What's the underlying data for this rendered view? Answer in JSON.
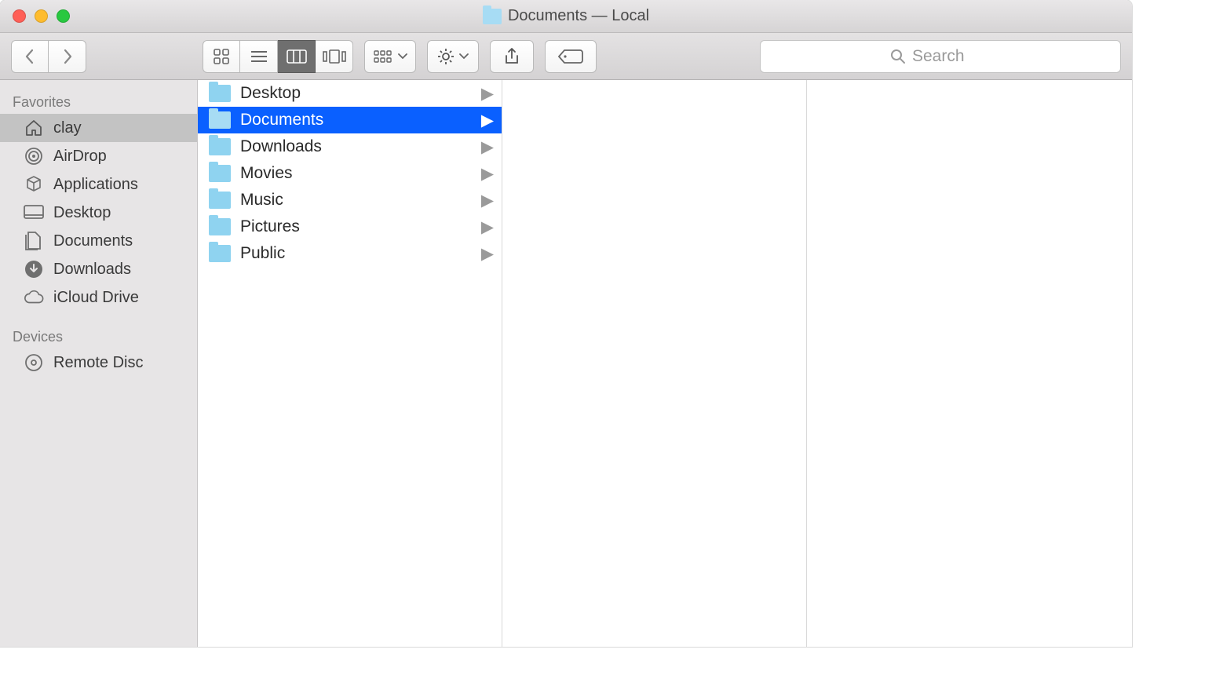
{
  "window": {
    "title": "Documents — Local"
  },
  "toolbar": {
    "search_placeholder": "Search"
  },
  "sidebar": {
    "sections": [
      {
        "heading": "Favorites",
        "items": [
          {
            "icon": "home-icon",
            "label": "clay",
            "selected": true
          },
          {
            "icon": "airdrop-icon",
            "label": "AirDrop",
            "selected": false
          },
          {
            "icon": "applications-icon",
            "label": "Applications",
            "selected": false
          },
          {
            "icon": "desktop-icon",
            "label": "Desktop",
            "selected": false
          },
          {
            "icon": "documents-icon",
            "label": "Documents",
            "selected": false
          },
          {
            "icon": "downloads-icon",
            "label": "Downloads",
            "selected": false
          },
          {
            "icon": "cloud-icon",
            "label": "iCloud Drive",
            "selected": false
          }
        ]
      },
      {
        "heading": "Devices",
        "items": [
          {
            "icon": "disc-icon",
            "label": "Remote Disc",
            "selected": false
          }
        ]
      }
    ]
  },
  "column0": {
    "items": [
      {
        "label": "Desktop",
        "selected": false
      },
      {
        "label": "Documents",
        "selected": true
      },
      {
        "label": "Downloads",
        "selected": false
      },
      {
        "label": "Movies",
        "selected": false
      },
      {
        "label": "Music",
        "selected": false
      },
      {
        "label": "Pictures",
        "selected": false
      },
      {
        "label": "Public",
        "selected": false
      }
    ]
  }
}
